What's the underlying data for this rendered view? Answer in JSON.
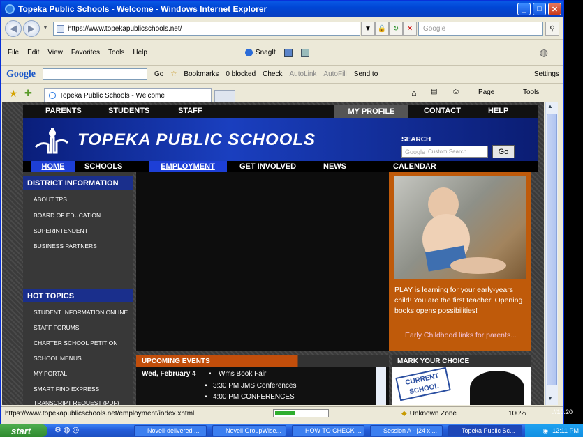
{
  "window": {
    "title": "Topeka Public Schools - Welcome - Windows Internet Explorer"
  },
  "address": {
    "url": "https://www.topekapublicschools.net/",
    "search_placeholder": "Google"
  },
  "menu": [
    "File",
    "Edit",
    "View",
    "Favorites",
    "Tools",
    "Help"
  ],
  "snagit": "SnagIt",
  "googlebar": {
    "logo": "Google",
    "go": "Go",
    "bookmarks": "Bookmarks",
    "blocked": "0 blocked",
    "check": "Check",
    "autolink": "AutoLink",
    "autofill": "AutoFill",
    "sendto": "Send to",
    "settings": "Settings"
  },
  "tab": {
    "title": "Topeka Public Schools - Welcome"
  },
  "cmdbar": {
    "page": "Page",
    "tools": "Tools"
  },
  "site": {
    "utility": [
      "PARENTS",
      "STUDENTS",
      "STAFF"
    ],
    "utility_right": [
      "MY PROFILE",
      "CONTACT",
      "HELP"
    ],
    "name": "TOPEKA PUBLIC SCHOOLS",
    "search_label": "SEARCH",
    "search_placeholder": "Custom Search",
    "search_google": "Google",
    "search_go": "Go",
    "nav": [
      "HOME",
      "SCHOOLS",
      "EMPLOYMENT",
      "GET INVOLVED",
      "NEWS",
      "CALENDAR"
    ],
    "district_heading": "DISTRICT INFORMATION",
    "district_items": [
      "ABOUT TPS",
      "BOARD OF EDUCATION",
      "SUPERINTENDENT",
      "BUSINESS PARTNERS"
    ],
    "hot_heading": "HOT TOPICS",
    "hot_items": [
      "STUDENT INFORMATION ONLINE",
      "STAFF FORUMS",
      "CHARTER SCHOOL PETITION",
      "SCHOOL MENUS",
      "MY PORTAL",
      "SMART FIND EXPRESS",
      "TRANSCRIPT REQUEST (PDF)"
    ],
    "promo_text": "PLAY is learning for your early-years child! You are the first teacher. Opening books opens possibilities!",
    "promo_link": "Early Childhood links for parents...",
    "events_heading": "UPCOMING EVENTS",
    "events_date": "Wed, February 4",
    "events": [
      "Wms Book Fair",
      "3:30 PM JMS Conferences",
      "4:00 PM CONFERENCES"
    ],
    "mark_heading": "MARK YOUR CHOICE",
    "mark_sign": "CURRENT SCHOOL"
  },
  "status": {
    "url": "https://www.topekapublicschools.net/employment/index.xhtml",
    "zone": "Unknown Zone",
    "zoom": "100%"
  },
  "taskbar": {
    "start": "start",
    "items": [
      "Novell-delivered ...",
      "Novell GroupWise...",
      "HOW TO CHECK ...",
      "Session A - [24 x ...",
      "Topeka Public Sc..."
    ],
    "clock": "12:11 PM",
    "side_text": "://10.20"
  }
}
